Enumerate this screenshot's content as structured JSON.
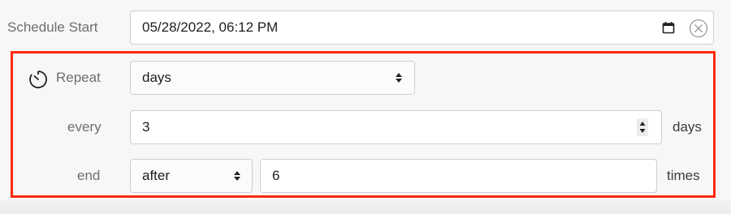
{
  "schedule": {
    "start_label": "Schedule Start",
    "start_value": "05/28/2022, 06:12 PM"
  },
  "repeat": {
    "label": "Repeat",
    "selected": "days",
    "every_label": "every",
    "every_value": "3",
    "every_unit": "days",
    "end_label": "end",
    "end_selected": "after",
    "end_value": "6",
    "end_unit": "times"
  },
  "icons": {
    "calendar": "calendar-icon",
    "clear": "clear-circle-icon",
    "timer": "timer-icon",
    "select_arrows": "updown-arrows-icon",
    "stepper": "spinner-arrows-icon"
  },
  "colors": {
    "highlight": "#ff2a0d",
    "label": "#6f6f6f",
    "border": "#cfcfcf"
  }
}
